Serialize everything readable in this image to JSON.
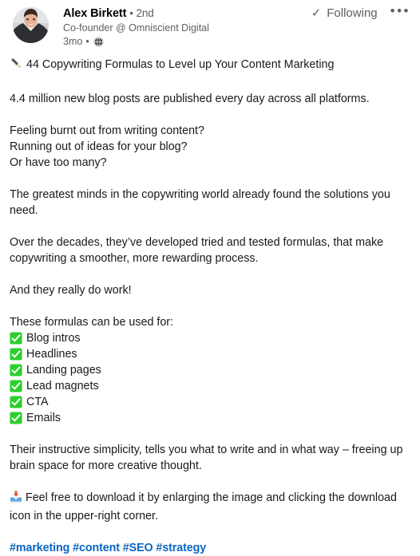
{
  "post": {
    "author": {
      "name": "Alex Birkett",
      "degree": "• 2nd",
      "headline": "Co-founder @ Omniscient Digital",
      "timestamp": "3mo",
      "meta_separator": "•"
    },
    "actions": {
      "following_label": "Following",
      "more_label": "•••"
    },
    "content": {
      "title": "44 Copywriting Formulas to Level up Your Content Marketing",
      "stat_line": "4.4 million new blog posts are published every day across all platforms.",
      "questions": [
        "Feeling burnt out from writing content?",
        "Running out of ideas for your blog?",
        "Or have too many?"
      ],
      "solutions_line": "The greatest minds in the copywriting world already found the solutions you need.",
      "decades_line": "Over the decades, they’ve developed tried and tested formulas, that make copywriting a smoother, more rewarding process.",
      "work_line": "And they really do work!",
      "list_intro": "These formulas can be used for:",
      "list_items": [
        "Blog intros",
        "Headlines",
        "Landing pages",
        "Lead magnets",
        "CTA",
        "Emails"
      ],
      "simplicity_line": "Their instructive simplicity, tells you what to write and in what way – freeing up brain space for more creative thought.",
      "download_line": "Feel free to download it by enlarging the image and clicking the download icon in the upper-right corner.",
      "hashtags": "#marketing #content #SEO #strategy"
    },
    "colors": {
      "link_blue": "#0a66c2",
      "text_primary": "#191919",
      "text_secondary": "#5f5f5f",
      "check_green": "#2ecd2e"
    }
  }
}
